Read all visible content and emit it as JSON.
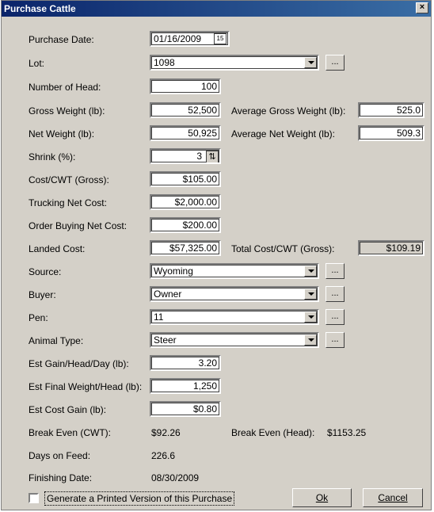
{
  "window": {
    "title": "Purchase Cattle",
    "close_glyph": "×"
  },
  "fields": {
    "purchase_date": {
      "label": "Purchase Date:",
      "value": "01/16/2009"
    },
    "lot": {
      "label": "Lot:",
      "value": "1098"
    },
    "number_of_head": {
      "label": "Number of Head:",
      "value": "100"
    },
    "gross_weight": {
      "label": "Gross Weight (lb):",
      "value": "52,500"
    },
    "avg_gross_weight": {
      "label": "Average Gross Weight (lb):",
      "value": "525.0"
    },
    "net_weight": {
      "label": "Net Weight (lb):",
      "value": "50,925"
    },
    "avg_net_weight": {
      "label": "Average Net Weight (lb):",
      "value": "509.3"
    },
    "shrink": {
      "label": "Shrink (%):",
      "value": "3"
    },
    "cost_cwt_gross": {
      "label": "Cost/CWT (Gross):",
      "value": "$105.00"
    },
    "trucking_net_cost": {
      "label": "Trucking Net Cost:",
      "value": "$2,000.00"
    },
    "order_buying_net_cost": {
      "label": "Order Buying Net Cost:",
      "value": "$200.00"
    },
    "landed_cost": {
      "label": "Landed Cost:",
      "value": "$57,325.00"
    },
    "total_cost_cwt": {
      "label": "Total Cost/CWT (Gross):",
      "value": "$109.19"
    },
    "source": {
      "label": "Source:",
      "value": "Wyoming"
    },
    "buyer": {
      "label": "Buyer:",
      "value": "Owner"
    },
    "pen": {
      "label": "Pen:",
      "value": "11"
    },
    "animal_type": {
      "label": "Animal Type:",
      "value": "Steer"
    },
    "est_gain_head_day": {
      "label": "Est Gain/Head/Day (lb):",
      "value": "3.20"
    },
    "est_final_weight_head": {
      "label": "Est Final Weight/Head (lb):",
      "value": "1,250"
    },
    "est_cost_gain": {
      "label": "Est Cost Gain (lb):",
      "value": "$0.80"
    },
    "break_even_cwt": {
      "label": "Break Even (CWT):",
      "value": "$92.26"
    },
    "break_even_head": {
      "label": "Break Even (Head):",
      "value": "$1153.25"
    },
    "days_on_feed": {
      "label": "Days on Feed:",
      "value": "226.6"
    },
    "finishing_date": {
      "label": "Finishing Date:",
      "value": "08/30/2009"
    }
  },
  "ellipsis_label": "...",
  "calendar_icon_text": "15",
  "print_checkbox": {
    "label": "Generate a Printed Version of this Purchase",
    "checked": false
  },
  "buttons": {
    "ok_label": "Ok",
    "cancel_label": "Cancel"
  }
}
